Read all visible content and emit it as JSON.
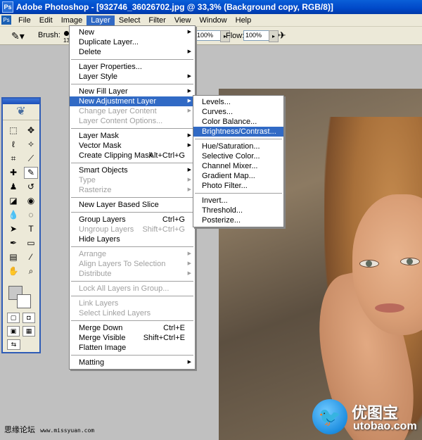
{
  "window": {
    "title": "Adobe Photoshop - [932746_36026702.jpg @ 33,3% (Background copy, RGB/8)]"
  },
  "menubar": {
    "items": [
      "File",
      "Edit",
      "Image",
      "Layer",
      "Select",
      "Filter",
      "View",
      "Window",
      "Help"
    ],
    "active": "Layer"
  },
  "options": {
    "brush_label": "Brush:",
    "brush_size": "13",
    "opacity_value": "100%",
    "flow_label": "Flow:",
    "flow_value": "100%"
  },
  "layer_menu": {
    "items": [
      {
        "label": "New",
        "submenu": true
      },
      {
        "label": "Duplicate Layer..."
      },
      {
        "label": "Delete",
        "submenu": true
      },
      {
        "sep": true
      },
      {
        "label": "Layer Properties..."
      },
      {
        "label": "Layer Style",
        "submenu": true
      },
      {
        "sep": true
      },
      {
        "label": "New Fill Layer",
        "submenu": true
      },
      {
        "label": "New Adjustment Layer",
        "submenu": true,
        "highlight": true
      },
      {
        "label": "Change Layer Content",
        "submenu": true,
        "disabled": true
      },
      {
        "label": "Layer Content Options...",
        "disabled": true
      },
      {
        "sep": true
      },
      {
        "label": "Layer Mask",
        "submenu": true
      },
      {
        "label": "Vector Mask",
        "submenu": true
      },
      {
        "label": "Create Clipping Mask",
        "shortcut": "Alt+Ctrl+G"
      },
      {
        "sep": true
      },
      {
        "label": "Smart Objects",
        "submenu": true
      },
      {
        "label": "Type",
        "submenu": true,
        "disabled": true
      },
      {
        "label": "Rasterize",
        "submenu": true,
        "disabled": true
      },
      {
        "sep": true
      },
      {
        "label": "New Layer Based Slice"
      },
      {
        "sep": true
      },
      {
        "label": "Group Layers",
        "shortcut": "Ctrl+G"
      },
      {
        "label": "Ungroup Layers",
        "shortcut": "Shift+Ctrl+G",
        "disabled": true
      },
      {
        "label": "Hide Layers"
      },
      {
        "sep": true
      },
      {
        "label": "Arrange",
        "submenu": true,
        "disabled": true
      },
      {
        "label": "Align Layers To Selection",
        "submenu": true,
        "disabled": true
      },
      {
        "label": "Distribute",
        "submenu": true,
        "disabled": true
      },
      {
        "sep": true
      },
      {
        "label": "Lock All Layers in Group...",
        "disabled": true
      },
      {
        "sep": true
      },
      {
        "label": "Link Layers",
        "disabled": true
      },
      {
        "label": "Select Linked Layers",
        "disabled": true
      },
      {
        "sep": true
      },
      {
        "label": "Merge Down",
        "shortcut": "Ctrl+E"
      },
      {
        "label": "Merge Visible",
        "shortcut": "Shift+Ctrl+E"
      },
      {
        "label": "Flatten Image"
      },
      {
        "sep": true
      },
      {
        "label": "Matting",
        "submenu": true
      }
    ]
  },
  "adjustment_submenu": {
    "items": [
      {
        "label": "Levels..."
      },
      {
        "label": "Curves..."
      },
      {
        "label": "Color Balance..."
      },
      {
        "label": "Brightness/Contrast...",
        "highlight": true
      },
      {
        "sep": true
      },
      {
        "label": "Hue/Saturation..."
      },
      {
        "label": "Selective Color..."
      },
      {
        "label": "Channel Mixer..."
      },
      {
        "label": "Gradient Map..."
      },
      {
        "label": "Photo Filter..."
      },
      {
        "sep": true
      },
      {
        "label": "Invert..."
      },
      {
        "label": "Threshold..."
      },
      {
        "label": "Posterize..."
      }
    ]
  },
  "watermarks": {
    "left_cn": "思缘论坛",
    "left_url": "www.missyuan.com",
    "right_cn": "优图宝",
    "right_en": "utobao.com"
  },
  "colors": {
    "titlebar": "#0048c8",
    "menu_highlight": "#316ac5",
    "ui_face": "#ece9d8",
    "workspace": "#c0c0c0"
  },
  "icons": {
    "tools": [
      "marquee-icon",
      "move-icon",
      "lasso-icon",
      "magic-wand-icon",
      "crop-icon",
      "slice-icon",
      "healing-brush-icon",
      "brush-icon",
      "stamp-icon",
      "history-brush-icon",
      "eraser-icon",
      "bucket-icon",
      "blur-icon",
      "dodge-icon",
      "path-select-icon",
      "type-icon",
      "pen-icon",
      "shape-icon",
      "notes-icon",
      "eyedropper-icon",
      "hand-icon",
      "zoom-icon"
    ]
  }
}
